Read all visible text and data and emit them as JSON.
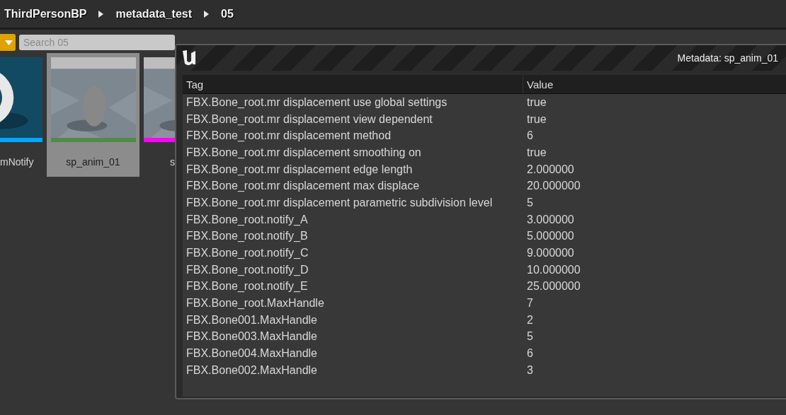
{
  "breadcrumbs": [
    "ThirdPersonBP",
    "metadata_test",
    "05"
  ],
  "search": {
    "placeholder": "Search 05"
  },
  "assets": [
    {
      "label": "mNotify",
      "selected": false,
      "color": "#00a8ff",
      "kind": "ring"
    },
    {
      "label": "sp_anim_01",
      "selected": true,
      "color": "#4f8a4a",
      "kind": "egg"
    },
    {
      "label": "s",
      "selected": false,
      "color": "#ff00ff",
      "kind": "egg"
    }
  ],
  "dialog": {
    "title": "Metadata: sp_anim_01",
    "columns": [
      "Tag",
      "Value"
    ],
    "rows": [
      [
        "FBX.Bone_root.mr displacement use global settings",
        "true"
      ],
      [
        "FBX.Bone_root.mr displacement view dependent",
        "true"
      ],
      [
        "FBX.Bone_root.mr displacement method",
        "6"
      ],
      [
        "FBX.Bone_root.mr displacement smoothing on",
        "true"
      ],
      [
        "FBX.Bone_root.mr displacement edge length",
        "2.000000"
      ],
      [
        "FBX.Bone_root.mr displacement max displace",
        "20.000000"
      ],
      [
        "FBX.Bone_root.mr displacement parametric subdivision level",
        "5"
      ],
      [
        "FBX.Bone_root.notify_A",
        "3.000000"
      ],
      [
        "FBX.Bone_root.notify_B",
        "5.000000"
      ],
      [
        "FBX.Bone_root.notify_C",
        "9.000000"
      ],
      [
        "FBX.Bone_root.notify_D",
        "10.000000"
      ],
      [
        "FBX.Bone_root.notify_E",
        "25.000000"
      ],
      [
        "FBX.Bone_root.MaxHandle",
        "7"
      ],
      [
        "FBX.Bone001.MaxHandle",
        "2"
      ],
      [
        "FBX.Bone003.MaxHandle",
        "5"
      ],
      [
        "FBX.Bone004.MaxHandle",
        "6"
      ],
      [
        "FBX.Bone002.MaxHandle",
        "3"
      ]
    ]
  }
}
